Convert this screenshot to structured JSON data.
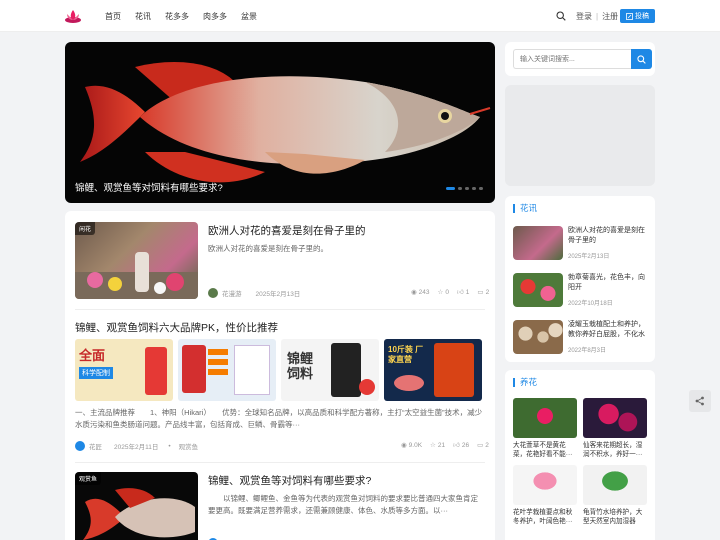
{
  "header": {
    "nav": [
      "首页",
      "花讯",
      "花多多",
      "肉多多",
      "盆景"
    ],
    "login": "登录",
    "register": "注册",
    "post_button": "投稿"
  },
  "hero": {
    "title": "锦鲤、观赏鱼等对饲料有哪些要求?",
    "slide_count": 5,
    "active_slide": 1
  },
  "posts": [
    {
      "tag": "闲花",
      "title": "欧洲人对花的喜爱是刻在骨子里的",
      "desc": "欧洲人对花的喜爱是刻在骨子里的。",
      "author": "花漫游",
      "date": "2025年2月13日",
      "views": "243",
      "stars": "0",
      "likes": "1",
      "comments": "2"
    },
    {
      "title": "锦鲤、观赏鱼饲料六大品牌PK，性价比推荐",
      "desc": "一、主流品牌推荐　　1、神阳（Hikari）　　优势：全球知名品牌，以高品质和科学配方著称，主打“太空益生菌”技术，减少水质污染和鱼类肠道问题。产品线丰富，包括育成、巨鳞、骨霸等···",
      "author": "花匠",
      "date": "2025年2月11日",
      "category": "观赏鱼",
      "views": "9.0K",
      "stars": "21",
      "likes": "26",
      "comments": "2",
      "gallery_text": [
        "全面",
        "科学配制",
        "锦鲤饲料",
        "10斤装 厂家直营"
      ]
    },
    {
      "tag": "观赏鱼",
      "title": "锦鲤、观赏鱼等对饲料有哪些要求?",
      "desc": "　　以锦鲤、鲫鲤鱼、金鱼等为代表的观赏鱼对饲料的要求要比普通四大家鱼肯定要更高。既要满足营养需求，还需兼顾健康、体色、水质等多方面。以···"
    }
  ],
  "sidebar": {
    "search_placeholder": "输入关键词搜索...",
    "news": {
      "title": "花讯",
      "items": [
        {
          "title": "欧洲人对花的喜爱是刻在骨子里的",
          "date": "2025年2月13日"
        },
        {
          "title": "勃章菊喜光，花色丰，向阳开",
          "date": "2022年10月18日"
        },
        {
          "title": "凌耀玉栽植配土和养护，教你养好白屁股，不化水",
          "date": "2022年8月3日"
        }
      ]
    },
    "care": {
      "title": "养花",
      "items": [
        {
          "title": "大花萱草不是黄花菜，花艳好看不能···"
        },
        {
          "title": "仙客来花期超长，湿润不积水，养好一···"
        },
        {
          "title": "花叶芋栽植要点和秋冬养护，叶阔色艳···"
        },
        {
          "title": "龟背竹水培养护，大型天然室内加湿器"
        }
      ]
    }
  }
}
